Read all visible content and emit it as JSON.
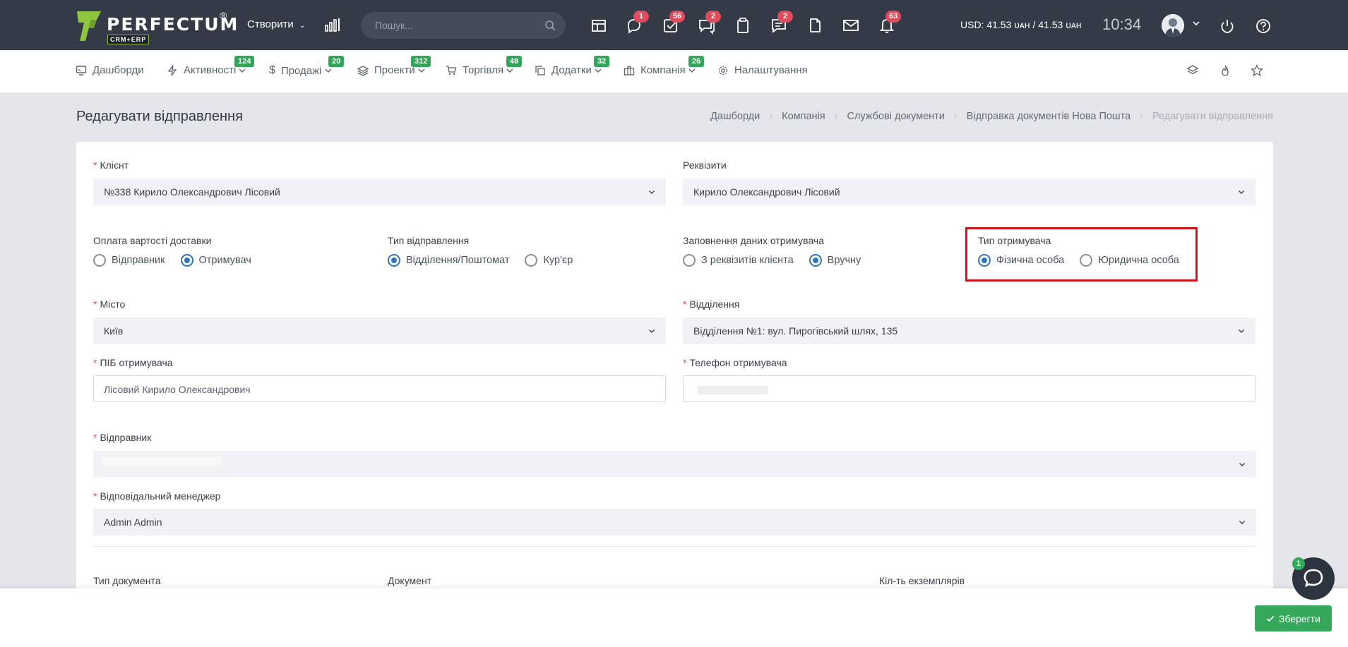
{
  "header": {
    "logo": "PERFECTUM",
    "logo_sub": "CRM+ERP",
    "logo_reg": "®",
    "create_label": "Створити",
    "search_placeholder": "Пошук...",
    "badges": {
      "chat": "1",
      "tasks": "56",
      "messages": "2",
      "comments": "2",
      "notifications": "63"
    },
    "rate": "USD: 41.53 ᴜᴀʜ / 41.53 ᴜᴀʜ",
    "time": "10:34"
  },
  "nav": {
    "items": [
      {
        "label": "Дашборди",
        "badge": ""
      },
      {
        "label": "Активності",
        "badge": "124"
      },
      {
        "label": "Продажі",
        "badge": "20"
      },
      {
        "label": "Проекти",
        "badge": "312"
      },
      {
        "label": "Торгівля",
        "badge": "48"
      },
      {
        "label": "Додатки",
        "badge": "32"
      },
      {
        "label": "Компанія",
        "badge": "26"
      },
      {
        "label": "Налаштування",
        "badge": ""
      }
    ]
  },
  "page": {
    "title": "Редагувати відправлення",
    "breadcrumb": [
      "Дашборди",
      "Компанія",
      "Службові документи",
      "Відправка документів Нова Пошта",
      "Редагувати відправлення"
    ]
  },
  "form": {
    "client_label": "Клієнт",
    "client_value": "№338 Кирило Олександрович Лісовий",
    "requisites_label": "Реквізити",
    "requisites_value": "Кирило Олександрович Лісовий",
    "payment_label": "Оплата вартості доставки",
    "payment_options": [
      "Відправник",
      "Отримувач"
    ],
    "shipment_type_label": "Тип відправлення",
    "shipment_type_options": [
      "Відділення/Поштомат",
      "Кур'єр"
    ],
    "recipient_data_label": "Заповнення даних отримувача",
    "recipient_data_options": [
      "З реквізитів клієнта",
      "Вручну"
    ],
    "recipient_type_label": "Тип отримувача",
    "recipient_type_options": [
      "Фізична особа",
      "Юридична особа"
    ],
    "city_label": "Місто",
    "city_value": "Київ",
    "branch_label": "Відділення",
    "branch_value": "Відділення №1: вул. Пирогівський шлях, 135",
    "recipient_name_label": "ПІБ отримувача",
    "recipient_name_value": "Лісовий Кирило Олександрович",
    "recipient_phone_label": "Телефон отримувача",
    "sender_label": "Відправник",
    "manager_label": "Відповідальний менеджер",
    "manager_value": "Admin Admin",
    "doc_type_label": "Тип документа",
    "document_label": "Документ",
    "copies_label": "Кіл-ть екземплярів"
  },
  "footer": {
    "save_label": "Зберегти",
    "chat_badge": "1"
  },
  "colors": {
    "topbar": "#343a46",
    "accent": "#2f75bc",
    "badge_red": "#e04c5d",
    "badge_green": "#33a65a",
    "highlight": "#d4141c"
  }
}
